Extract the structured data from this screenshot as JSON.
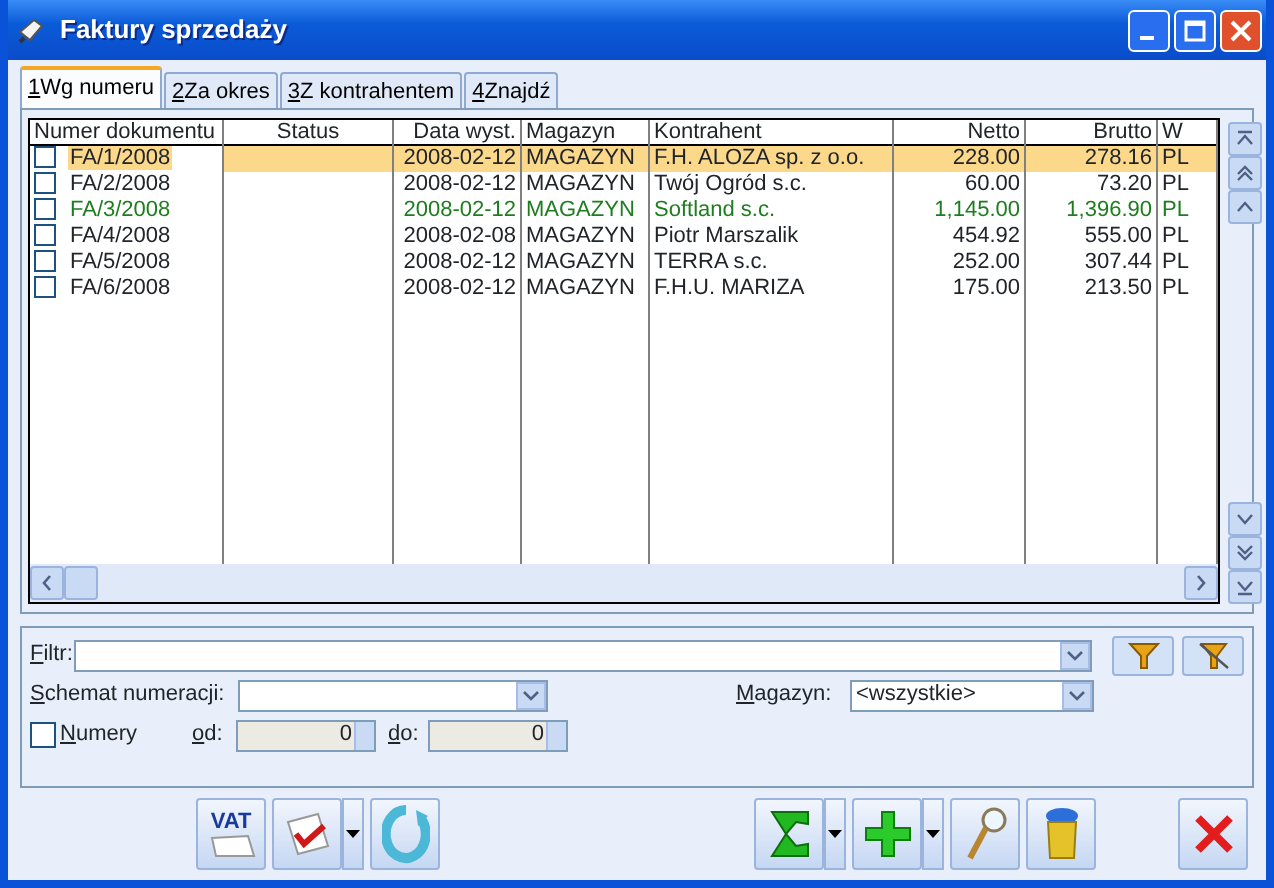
{
  "window": {
    "title": "Faktury sprzedaży"
  },
  "tabs": [
    {
      "key": "1",
      "label": "Wg numeru",
      "selected": true
    },
    {
      "key": "2",
      "label": "Za okres",
      "selected": false
    },
    {
      "key": "3",
      "label": "Z kontrahentem",
      "selected": false
    },
    {
      "key": "4",
      "label": "Znajdź",
      "selected": false
    }
  ],
  "table": {
    "columns": [
      "Numer dokumentu",
      "Status",
      "Data wyst.",
      "Magazyn",
      "Kontrahent",
      "Netto",
      "Brutto",
      "W"
    ],
    "rows": [
      {
        "checked": false,
        "selected": true,
        "cells": [
          "FA/1/2008",
          "",
          "2008-02-12",
          "MAGAZYN",
          "F.H. ALOZA sp. z o.o.",
          "228.00",
          "278.16",
          "PL"
        ]
      },
      {
        "checked": false,
        "selected": false,
        "cells": [
          "FA/2/2008",
          "",
          "2008-02-12",
          "MAGAZYN",
          "Twój Ogród s.c.",
          "60.00",
          "73.20",
          "PL"
        ]
      },
      {
        "checked": false,
        "selected": false,
        "color": "#1e7d1e",
        "cells": [
          "FA/3/2008",
          "",
          "2008-02-12",
          "MAGAZYN",
          "Softland s.c.",
          "1,145.00",
          "1,396.90",
          "PL"
        ]
      },
      {
        "checked": false,
        "selected": false,
        "cells": [
          "FA/4/2008",
          "",
          "2008-02-08",
          "MAGAZYN",
          "Piotr Marszalik",
          "454.92",
          "555.00",
          "PL"
        ]
      },
      {
        "checked": false,
        "selected": false,
        "cells": [
          "FA/5/2008",
          "",
          "2008-02-12",
          "MAGAZYN",
          "TERRA s.c.",
          "252.00",
          "307.44",
          "PL"
        ]
      },
      {
        "checked": false,
        "selected": false,
        "cells": [
          "FA/6/2008",
          "",
          "2008-02-12",
          "MAGAZYN",
          "F.H.U. MARIZA",
          "175.00",
          "213.50",
          "PL"
        ]
      }
    ]
  },
  "filters": {
    "filtr": {
      "label": "Filtr:"
    },
    "schemat": {
      "label": "Schemat numeracji:"
    },
    "magazyn": {
      "label": "Magazyn:",
      "value": "<wszystkie>"
    },
    "numery": {
      "label": "Numery",
      "checked": false
    },
    "od": {
      "label": "od:",
      "value": "0"
    },
    "do": {
      "label": "do:",
      "value": "0"
    }
  },
  "toolbar": {
    "left": [
      {
        "kind": "vat",
        "label": "VAT",
        "dropdown": false
      },
      {
        "kind": "approve",
        "dropdown": true
      },
      {
        "kind": "refresh",
        "dropdown": false
      }
    ],
    "middle": [
      {
        "kind": "sum",
        "dropdown": true
      },
      {
        "kind": "add",
        "dropdown": true
      },
      {
        "kind": "view",
        "dropdown": false
      },
      {
        "kind": "trash",
        "dropdown": false
      }
    ],
    "right": [
      {
        "kind": "close",
        "dropdown": false
      }
    ]
  }
}
